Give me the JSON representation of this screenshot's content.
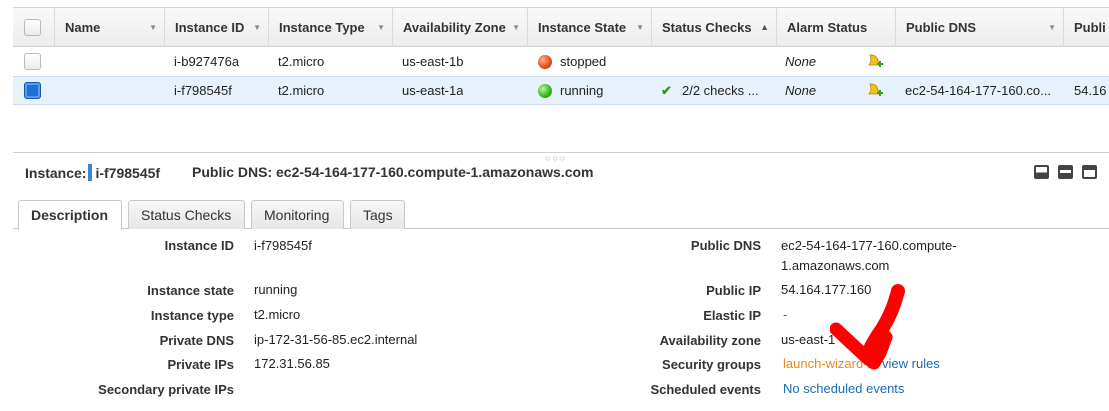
{
  "grid": {
    "columns": [
      {
        "label": "Name"
      },
      {
        "label": "Instance ID"
      },
      {
        "label": "Instance Type"
      },
      {
        "label": "Availability Zone"
      },
      {
        "label": "Instance State"
      },
      {
        "label": "Status Checks"
      },
      {
        "label": "Alarm Status"
      },
      {
        "label": "Public DNS"
      },
      {
        "label": "Publi"
      }
    ],
    "rows": [
      {
        "name": "",
        "instance_id": "i-b927476a",
        "instance_type": "t2.micro",
        "az": "us-east-1b",
        "state": "stopped",
        "status_checks": "",
        "alarm": "None",
        "public_dns": "",
        "public_ip": "",
        "selected": false
      },
      {
        "name": "",
        "instance_id": "i-f798545f",
        "instance_type": "t2.micro",
        "az": "us-east-1a",
        "state": "running",
        "status_checks": "2/2 checks ...",
        "alarm": "None",
        "public_dns": "ec2-54-164-177-160.co...",
        "public_ip": "54.16",
        "selected": true
      }
    ]
  },
  "details": {
    "instance_label": "Instance:",
    "instance_id": "i-f798545f",
    "public_dns_label": "Public DNS:",
    "public_dns": "ec2-54-164-177-160.compute-1.amazonaws.com",
    "tabs": [
      {
        "label": "Description",
        "active": true
      },
      {
        "label": "Status Checks",
        "active": false
      },
      {
        "label": "Monitoring",
        "active": false
      },
      {
        "label": "Tags",
        "active": false
      }
    ],
    "left": [
      {
        "label": "Instance ID",
        "value": "i-f798545f"
      },
      {
        "label": "Instance state",
        "value": "running"
      },
      {
        "label": "Instance type",
        "value": "t2.micro"
      },
      {
        "label": "Private DNS",
        "value": "ip-172-31-56-85.ec2.internal"
      },
      {
        "label": "Private IPs",
        "value": "172.31.56.85"
      },
      {
        "label": "Secondary private IPs",
        "value": ""
      }
    ],
    "right": {
      "public_dns_label": "Public DNS",
      "public_dns_line1": "ec2-54-164-177-160.compute-",
      "public_dns_line2": "1.amazonaws.com",
      "public_ip_label": "Public IP",
      "public_ip": "54.164.177.160",
      "elastic_ip_label": "Elastic IP",
      "elastic_ip": "-",
      "az_label": "Availability zone",
      "az": "us-east-1",
      "sg_label": "Security groups",
      "sg_link": "launch-wizard-2",
      "sg_sep": ".",
      "sg_view": "view rules",
      "sched_label": "Scheduled events",
      "sched_link": "No scheduled events"
    }
  },
  "colors": {
    "selected_row": "#e7f1fb",
    "link": "#1a6bb3",
    "link_orange": "#e38a1e",
    "annotation_arrow": "#ff0000"
  }
}
